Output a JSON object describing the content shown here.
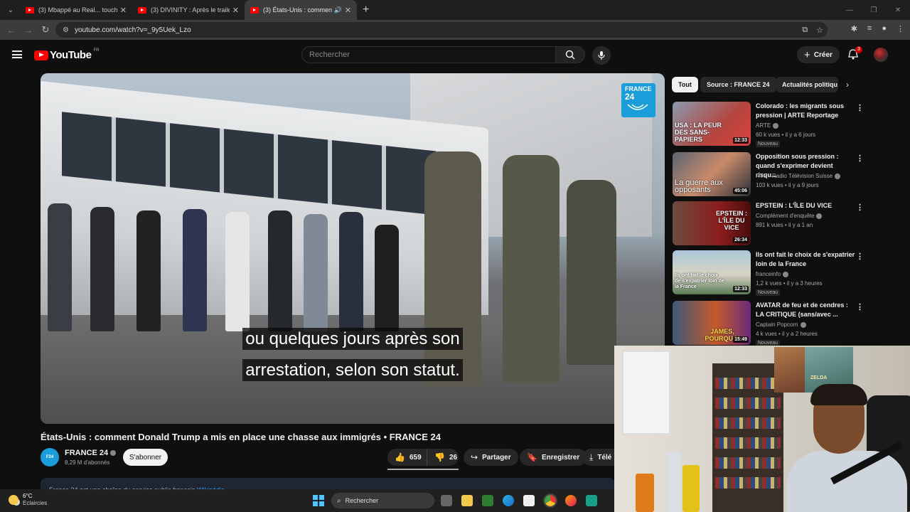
{
  "browser": {
    "tabs": [
      {
        "title": "(3) Mbappé au Real... touché p..."
      },
      {
        "title": "(3) DIVINITY : Après le trailer, L..."
      },
      {
        "title": "(3) États-Unis : comment D..."
      }
    ],
    "url": "youtube.com/watch?v=_9y5Uek_Lzo"
  },
  "youtube": {
    "logo_text": "YouTube",
    "country": "FR",
    "search_placeholder": "Rechercher",
    "create_label": "Créer",
    "notification_count": "3"
  },
  "video": {
    "subtitle_line1": "ou quelques jours après son",
    "subtitle_line2": "arrestation, selon son statut.",
    "watermark_line1": "FRANCE",
    "watermark_line2": "24",
    "title": "États-Unis : comment Donald Trump a mis en place une chasse aux immigrés • FRANCE 24",
    "channel": "FRANCE 24",
    "subscribers": "8,29 M d'abonnés",
    "subscribe_label": "S'abonner",
    "likes": "659",
    "dislikes": "26",
    "share_label": "Partager",
    "save_label": "Enregistrer",
    "download_label": "Télé",
    "description": "France 24 est une chaîne du service public français",
    "description_link": "Wikipédia"
  },
  "chips": [
    "Tout",
    "Source : FRANCE 24",
    "Actualités politiqu"
  ],
  "recommendations": [
    {
      "title": "Colorado : les migrants sous pression | ARTE Reportage",
      "channel": "ARTE",
      "meta": "60 k vues • il y a 6 jours",
      "badge": "Nouveau",
      "duration": "12:33",
      "thumb_text": "USA : LA PEUR DES SANS-PAPIERS"
    },
    {
      "title": "Opposition sous pression : quand s'exprimer devient risqu...",
      "channel": "RTS - Radio Télévision Suisse",
      "meta": "103 k vues • il y a 9 jours",
      "badge": "",
      "duration": "45:06",
      "thumb_text": "La guerre aux opposants"
    },
    {
      "title": "EPSTEIN : L'ÎLE DU VICE",
      "channel": "Complément d'enquête",
      "meta": "891 k vues • il y a 1 an",
      "badge": "",
      "duration": "26:34",
      "thumb_text": "EPSTEIN : L'ÎLE DU VICE"
    },
    {
      "title": "Ils ont fait le choix de s'expatrier loin de la France",
      "channel": "franceinfo",
      "meta": "1,2 k vues • il y a 3 heures",
      "badge": "Nouveau",
      "duration": "12:33",
      "thumb_text": "Ils ont fait le choix de s'expatrier loin de la France"
    },
    {
      "title": "AVATAR de feu et de cendres : LA CRITIQUE (sans/avec ...",
      "channel": "Captain Popcorn",
      "meta": "4 k vues • il y a 2 heures",
      "badge": "Nouveau",
      "duration": "15:49",
      "thumb_text": "JAMES, POURQUOI"
    }
  ],
  "webcam": {
    "poster_text": "ZELDA"
  },
  "taskbar": {
    "temperature": "6°C",
    "weather": "Eclaircies",
    "search_label": "Rechercher"
  },
  "colors": {
    "accent_red": "#ff0000",
    "france24_blue": "#1a9dd9",
    "link_blue": "#3ea6ff"
  }
}
